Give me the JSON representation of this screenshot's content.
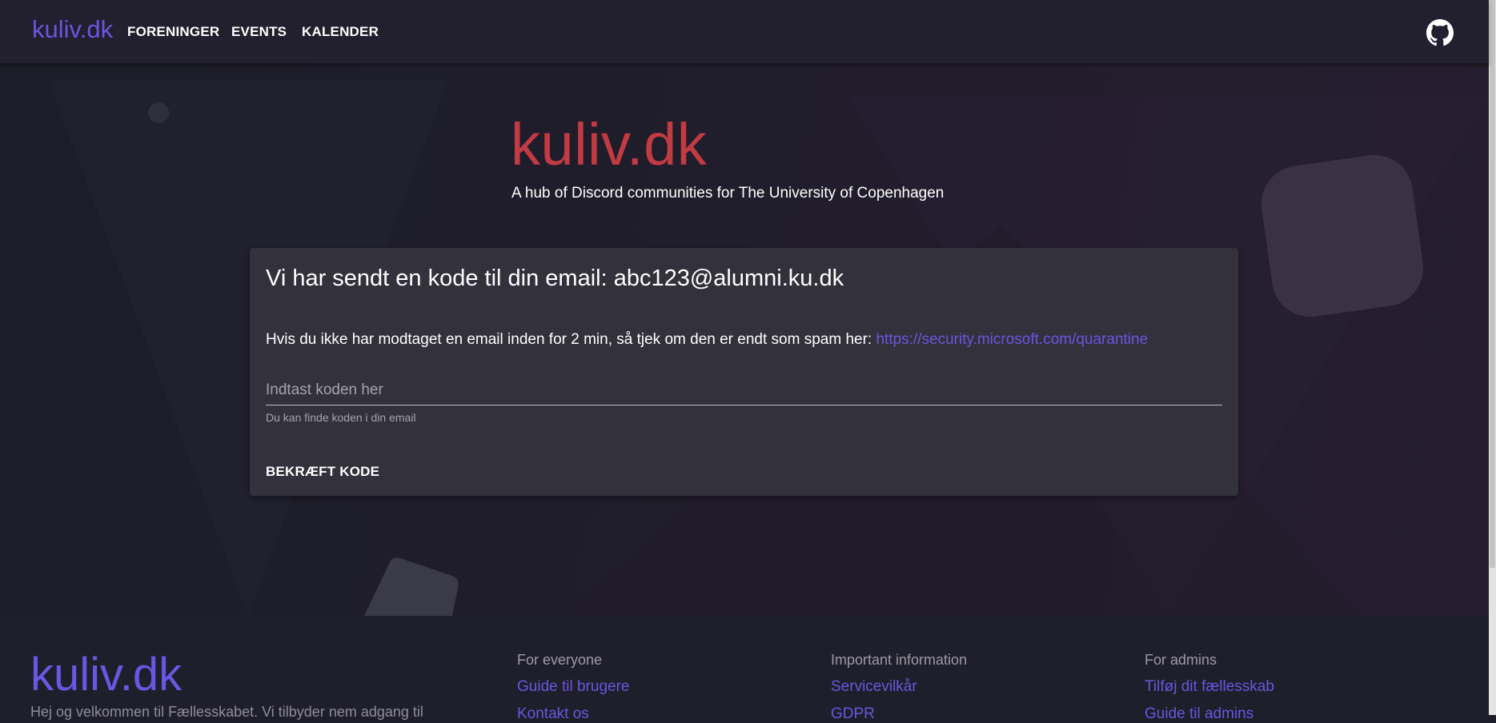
{
  "nav": {
    "brand": "kuliv.dk",
    "links": [
      "FORENINGER",
      "EVENTS",
      "KALENDER"
    ],
    "github_icon": "github-icon"
  },
  "hero": {
    "title": "kuliv.dk",
    "subtitle": "A hub of Discord communities for The University of Copenhagen"
  },
  "card": {
    "title": "Vi har sendt en kode til din email: abc123@alumni.ku.dk",
    "info_text": "Hvis du ikke har modtaget en email inden for 2 min, så tjek om den er endt som spam her: ",
    "link_text": "https://security.microsoft.com/quarantine",
    "input_placeholder": "Indtast koden her",
    "input_value": "",
    "hint": "Du kan finde koden i din email",
    "confirm_label": "BEKRÆFT KODE"
  },
  "footer": {
    "brand": "kuliv.dk",
    "description": "Hej og velkommen til Fællesskabet. Vi tilbyder nem adgang til",
    "columns": [
      {
        "heading": "For everyone",
        "links": [
          "Guide til brugere",
          "Kontakt os"
        ]
      },
      {
        "heading": "Important information",
        "links": [
          "Servicevilkår",
          "GDPR"
        ]
      },
      {
        "heading": "For admins",
        "links": [
          "Tilføj dit fællesskab",
          "Guide til admins"
        ]
      }
    ]
  },
  "colors": {
    "accent": "#6a56e0",
    "title_red": "#c23a42",
    "card_bg": "#32313c",
    "header_bg": "#221f2e"
  }
}
